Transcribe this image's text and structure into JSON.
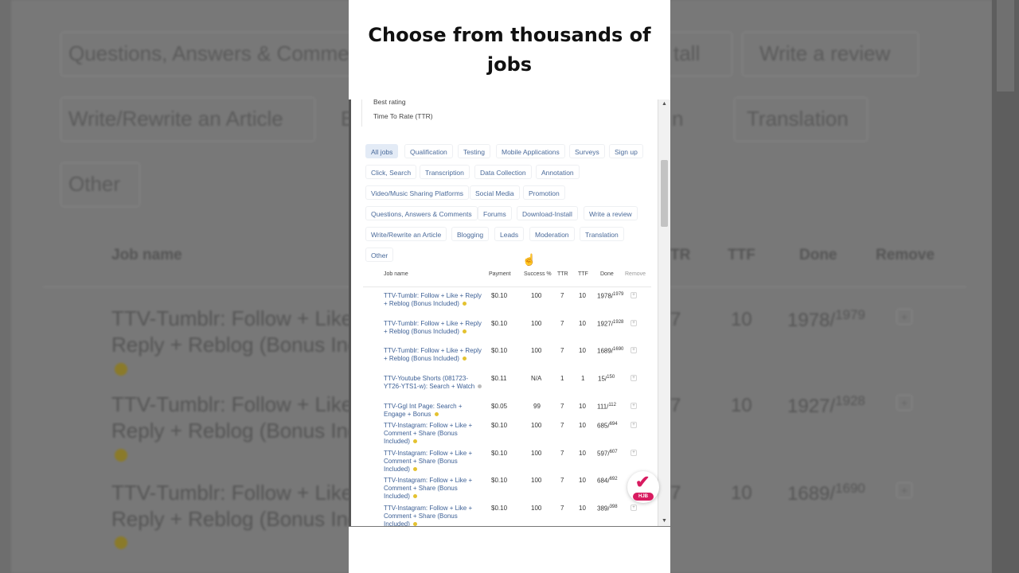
{
  "headline": "Choose from thousands of jobs",
  "sort_options": [
    "Best rating",
    "Time To Rate (TTR)"
  ],
  "categories": [
    "All jobs",
    "Qualification",
    "Testing",
    "Mobile Applications",
    "Surveys",
    "Sign up",
    "Click, Search",
    "Transcription",
    "Data Collection",
    "Annotation",
    "Video/Music Sharing Platforms",
    "Social Media",
    "Promotion",
    "Questions, Answers & Comments",
    "Forums",
    "Download-Install",
    "Write a review",
    "Write/Rewrite an Article",
    "Blogging",
    "Leads",
    "Moderation",
    "Translation",
    "Other"
  ],
  "active_category": "All jobs",
  "table": {
    "headers": {
      "job_name": "Job name",
      "payment": "Payment",
      "success": "Success %",
      "ttr": "TTR",
      "ttf": "TTF",
      "done": "Done",
      "remove": "Remove"
    },
    "rows": [
      {
        "name": "TTV-Tumblr: Follow + Like + Reply + Reblog (Bonus Included)",
        "payment": "$0.10",
        "success": "100",
        "ttr": "7",
        "ttf": "10",
        "done": "1978",
        "total": "1979"
      },
      {
        "name": "TTV-Tumblr: Follow + Like + Reply + Reblog (Bonus Included)",
        "payment": "$0.10",
        "success": "100",
        "ttr": "7",
        "ttf": "10",
        "done": "1927",
        "total": "1928"
      },
      {
        "name": "TTV-Tumblr: Follow + Like + Reply + Reblog (Bonus Included)",
        "payment": "$0.10",
        "success": "100",
        "ttr": "7",
        "ttf": "10",
        "done": "1689",
        "total": "1690"
      },
      {
        "name": "TTV-Youtube Shorts (081723-YT26-YTS1-w): Search + Watch",
        "payment": "$0.11",
        "success": "N/A",
        "ttr": "1",
        "ttf": "1",
        "done": "15",
        "total": "150"
      },
      {
        "name": "TTV-Ggl Int Page: Search + Engage + Bonus",
        "payment": "$0.05",
        "success": "99",
        "ttr": "7",
        "ttf": "10",
        "done": "111",
        "total": "112"
      },
      {
        "name": "TTV-Instagram: Follow + Like + Comment + Share (Bonus Included)",
        "payment": "$0.10",
        "success": "100",
        "ttr": "7",
        "ttf": "10",
        "done": "685",
        "total": "694"
      },
      {
        "name": "TTV-Instagram: Follow + Like + Comment + Share (Bonus Included)",
        "payment": "$0.10",
        "success": "100",
        "ttr": "7",
        "ttf": "10",
        "done": "597",
        "total": "607"
      },
      {
        "name": "TTV-Instagram: Follow + Like + Comment + Share (Bonus Included)",
        "payment": "$0.10",
        "success": "100",
        "ttr": "7",
        "ttf": "10",
        "done": "684",
        "total": "692"
      },
      {
        "name": "TTV-Instagram: Follow + Like + Comment + Share (Bonus Included)",
        "payment": "$0.10",
        "success": "100",
        "ttr": "7",
        "ttf": "10",
        "done": "389",
        "total": "398"
      }
    ]
  },
  "badge": {
    "icon": "check-icon",
    "label": "HJB"
  },
  "background": {
    "chips": [
      "Questions, Answers & Comme",
      "tall",
      "Write a review",
      "Write/Rewrite an Article",
      "B",
      "n",
      "Translation",
      "Other"
    ],
    "headers": [
      "Job name",
      "TR",
      "TTF",
      "Done",
      "Remove"
    ],
    "row_names": [
      "TTV-Tumblr: Follow + Like",
      "Reply + Reblog (Bonus Inc",
      "TTV-Tumblr: Follow + Like",
      "Reply + Reblog (Bonus Inc",
      "TTV-Tumblr: Follow + Like",
      "Reply + Reblog (Bonus Inc"
    ],
    "row_nums": [
      {
        "a": "7",
        "b": "10",
        "done": "1978/",
        "total": "1979"
      },
      {
        "a": "7",
        "b": "10",
        "done": "1927/",
        "total": "1928"
      },
      {
        "a": "7",
        "b": "10",
        "done": "1689/",
        "total": "1690"
      }
    ]
  },
  "colors": {
    "accent": "#3c5f95",
    "active_chip": "#e3ebf6",
    "badge": "#d81b60",
    "coin": "#e4c230"
  }
}
